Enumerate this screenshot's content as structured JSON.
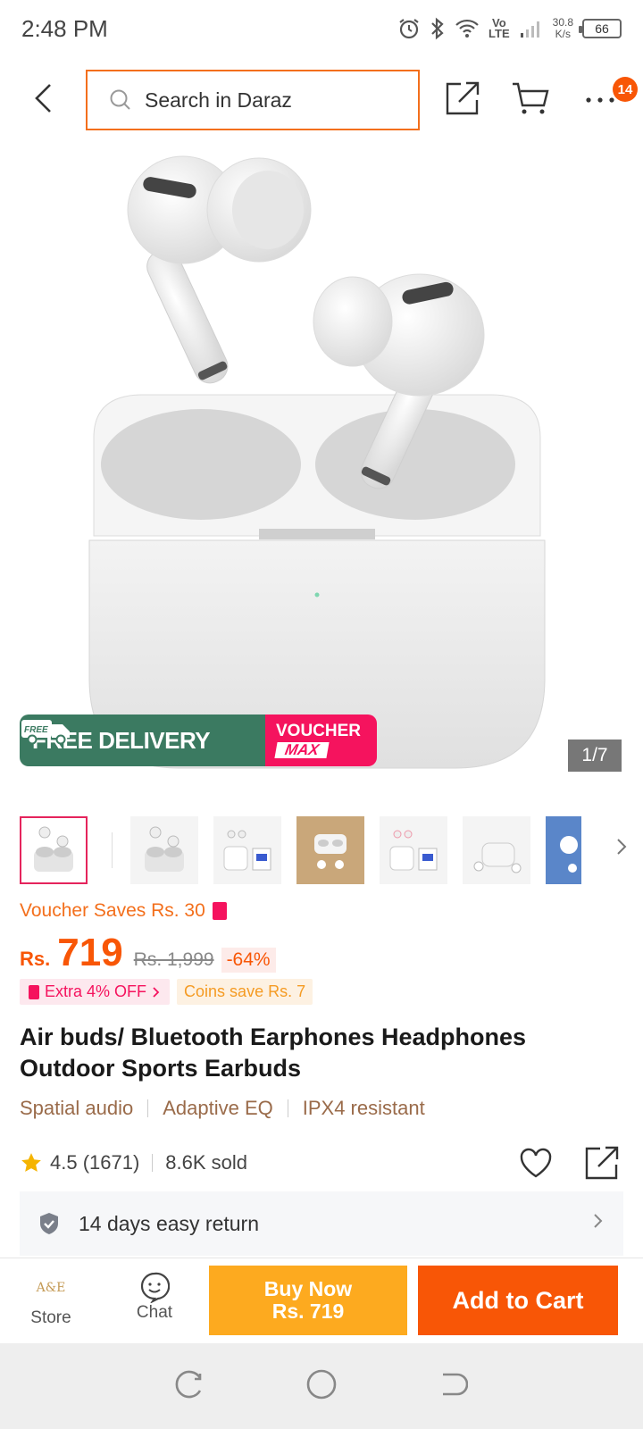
{
  "status_bar": {
    "time": "2:48 PM",
    "volte": "Vo\nLTE",
    "net_speed_value": "30.8",
    "net_speed_unit": "K/s",
    "battery": "66"
  },
  "header": {
    "search_placeholder": "Search in Daraz",
    "cart_badge": "14"
  },
  "gallery": {
    "promo_delivery": "FREE DELIVERY",
    "promo_free_small": "FREE",
    "promo_voucher_line1": "VOUCHER",
    "promo_voucher_line2": "MAX",
    "counter": "1/7",
    "thumbnails_count": 7
  },
  "pricing": {
    "voucher_saves": "Voucher Saves Rs. 30",
    "currency": "Rs.",
    "price": "719",
    "old_price": "Rs. 1,999",
    "discount": "-64%",
    "extra_off": "Extra 4% OFF",
    "coins_save": "Coins save Rs. 7"
  },
  "product": {
    "title": "Air buds/ Bluetooth Earphones Headphones Outdoor Sports Earbuds",
    "features": [
      "Spatial audio",
      "Adaptive EQ",
      "IPX4 resistant"
    ],
    "rating": "4.5 (1671)",
    "sold": "8.6K sold",
    "return_policy": "14 days easy return"
  },
  "actions": {
    "store_label": "Store",
    "store_logo_text": "A&E",
    "chat_label": "Chat",
    "buy_now_line1": "Buy Now",
    "buy_now_line2": "Rs. 719",
    "add_to_cart": "Add to Cart"
  },
  "colors": {
    "brand_orange": "#f85606",
    "buy_now_yellow": "#fdaa1f",
    "voucher_pink": "#f5135e",
    "delivery_green": "#3b7a61"
  }
}
